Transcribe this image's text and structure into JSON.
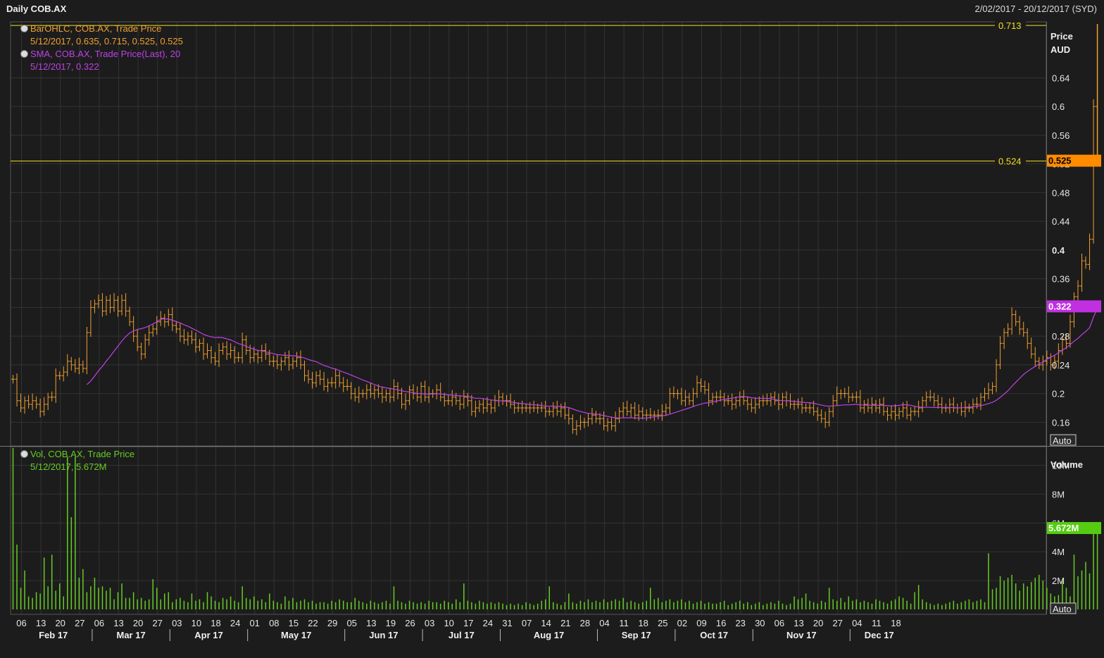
{
  "header": {
    "title": "Daily COB.AX",
    "date_range": "2/02/2017 - 20/12/2017 (SYD)"
  },
  "legend": {
    "ohlc_name": "BarOHLC, COB.AX, Trade Price",
    "ohlc_values": "5/12/2017, 0.635, 0.715, 0.525, 0.525",
    "sma_name": "SMA, COB.AX, Trade Price(Last),  20",
    "sma_values": "5/12/2017, 0.322",
    "vol_name": "Vol, COB.AX, Trade Price",
    "vol_values": "5/12/2017, 5.672M"
  },
  "colors": {
    "background": "#1c1c1c",
    "grid": "#333333",
    "ohlc": "#f0a030",
    "sma": "#c040e8",
    "volume": "#66cc22",
    "hline": "#f0e020",
    "last_price_badge": "#ff8c00",
    "sma_badge": "#c030e0",
    "volume_badge": "#55cc11"
  },
  "chart_data": {
    "type": "line",
    "price_axis": {
      "label_line1": "Price",
      "label_line2": "AUD",
      "ticks": [
        0.16,
        0.2,
        0.24,
        0.28,
        0.32,
        0.36,
        0.4,
        0.44,
        0.48,
        0.52,
        0.56,
        0.6,
        0.64
      ],
      "tick_labels": [
        "0.16",
        "0.2",
        "0.24",
        "0.28",
        "0.32",
        "0.36",
        "0.4",
        "0.44",
        "0.48",
        "0.52",
        "0.56",
        "0.6",
        "0.64"
      ],
      "ylim": [
        0.127,
        0.718
      ],
      "mode_button": "Auto"
    },
    "volume_axis": {
      "label": "Volume",
      "ticks": [
        2,
        4,
        6,
        8,
        10
      ],
      "tick_labels": [
        "2M",
        "4M",
        "6M",
        "8M",
        "10M"
      ],
      "ylim": [
        0,
        11.2
      ],
      "mode_button": "Auto"
    },
    "x_axis": {
      "day_labels": [
        "06",
        "13",
        "20",
        "27",
        "06",
        "13",
        "20",
        "27",
        "03",
        "10",
        "18",
        "24",
        "01",
        "08",
        "15",
        "22",
        "29",
        "05",
        "13",
        "19",
        "26",
        "03",
        "10",
        "17",
        "24",
        "31",
        "07",
        "14",
        "21",
        "28",
        "04",
        "11",
        "18",
        "25",
        "02",
        "09",
        "16",
        "23",
        "30",
        "06",
        "13",
        "20",
        "27",
        "04",
        "11",
        "18"
      ],
      "month_labels": [
        "Feb 17",
        "Mar 17",
        "Apr 17",
        "May 17",
        "Jun 17",
        "Jul 17",
        "Aug 17",
        "Sep 17",
        "Oct 17",
        "Nov 17",
        "Dec 17"
      ],
      "bars_per_label": 5
    },
    "horizontal_lines": [
      {
        "value": 0.713,
        "label": "0.713"
      },
      {
        "value": 0.524,
        "label": "0.524"
      }
    ],
    "last_price": {
      "value": 0.525,
      "label": "0.525"
    },
    "sma_last": {
      "value": 0.322,
      "label": "0.322"
    },
    "volume_last": {
      "value": 5.672,
      "label": "5.672M"
    },
    "close": [
      0.22,
      0.19,
      0.18,
      0.19,
      0.185,
      0.19,
      0.185,
      0.175,
      0.185,
      0.195,
      0.195,
      0.225,
      0.225,
      0.23,
      0.245,
      0.24,
      0.235,
      0.24,
      0.235,
      0.285,
      0.32,
      0.325,
      0.33,
      0.315,
      0.33,
      0.32,
      0.33,
      0.315,
      0.33,
      0.315,
      0.3,
      0.28,
      0.265,
      0.255,
      0.275,
      0.285,
      0.29,
      0.3,
      0.305,
      0.3,
      0.31,
      0.295,
      0.29,
      0.28,
      0.275,
      0.28,
      0.275,
      0.265,
      0.27,
      0.255,
      0.26,
      0.25,
      0.245,
      0.26,
      0.265,
      0.255,
      0.26,
      0.25,
      0.25,
      0.275,
      0.26,
      0.25,
      0.255,
      0.25,
      0.26,
      0.255,
      0.245,
      0.245,
      0.24,
      0.245,
      0.25,
      0.24,
      0.245,
      0.25,
      0.24,
      0.225,
      0.22,
      0.215,
      0.225,
      0.22,
      0.21,
      0.215,
      0.215,
      0.225,
      0.215,
      0.21,
      0.21,
      0.2,
      0.195,
      0.2,
      0.2,
      0.205,
      0.2,
      0.205,
      0.2,
      0.195,
      0.2,
      0.195,
      0.21,
      0.2,
      0.185,
      0.19,
      0.205,
      0.2,
      0.195,
      0.21,
      0.195,
      0.2,
      0.2,
      0.205,
      0.195,
      0.19,
      0.19,
      0.195,
      0.19,
      0.185,
      0.195,
      0.19,
      0.175,
      0.18,
      0.185,
      0.18,
      0.185,
      0.18,
      0.19,
      0.195,
      0.19,
      0.19,
      0.185,
      0.18,
      0.18,
      0.18,
      0.18,
      0.18,
      0.18,
      0.18,
      0.18,
      0.175,
      0.175,
      0.18,
      0.175,
      0.18,
      0.17,
      0.165,
      0.15,
      0.155,
      0.16,
      0.16,
      0.165,
      0.17,
      0.165,
      0.165,
      0.155,
      0.16,
      0.155,
      0.165,
      0.175,
      0.18,
      0.175,
      0.18,
      0.17,
      0.175,
      0.17,
      0.17,
      0.17,
      0.17,
      0.17,
      0.175,
      0.18,
      0.2,
      0.2,
      0.2,
      0.19,
      0.195,
      0.19,
      0.2,
      0.215,
      0.21,
      0.205,
      0.19,
      0.195,
      0.195,
      0.195,
      0.19,
      0.19,
      0.185,
      0.19,
      0.195,
      0.19,
      0.185,
      0.18,
      0.185,
      0.19,
      0.19,
      0.19,
      0.195,
      0.19,
      0.185,
      0.195,
      0.19,
      0.185,
      0.185,
      0.185,
      0.18,
      0.18,
      0.18,
      0.175,
      0.17,
      0.165,
      0.16,
      0.175,
      0.19,
      0.2,
      0.2,
      0.2,
      0.195,
      0.195,
      0.195,
      0.18,
      0.185,
      0.18,
      0.185,
      0.18,
      0.185,
      0.175,
      0.17,
      0.175,
      0.17,
      0.175,
      0.18,
      0.17,
      0.175,
      0.175,
      0.18,
      0.19,
      0.195,
      0.195,
      0.19,
      0.185,
      0.18,
      0.18,
      0.185,
      0.18,
      0.18,
      0.175,
      0.18,
      0.18,
      0.185,
      0.185,
      0.195,
      0.2,
      0.205,
      0.21,
      0.24,
      0.27,
      0.285,
      0.29,
      0.31,
      0.3,
      0.29,
      0.285,
      0.27,
      0.255,
      0.245,
      0.24,
      0.245,
      0.25,
      0.24,
      0.245,
      0.26,
      0.275,
      0.27,
      0.3,
      0.335,
      0.35,
      0.385,
      0.38,
      0.415,
      0.6,
      0.525
    ],
    "volume": [
      11.8,
      4.5,
      1.5,
      2.7,
      0.9,
      0.8,
      1.2,
      1.1,
      3.6,
      1.6,
      3.8,
      1.3,
      1.8,
      0.9,
      10.6,
      6.4,
      10.6,
      2.2,
      2.8,
      1.2,
      1.6,
      2.2,
      1.5,
      1.6,
      1.3,
      1.5,
      0.7,
      1.2,
      1.8,
      0.8,
      0.8,
      1.2,
      0.7,
      0.8,
      0.6,
      0.7,
      2.1,
      1.5,
      0.7,
      1.1,
      1.2,
      0.5,
      0.7,
      0.8,
      0.6,
      0.5,
      1.1,
      0.6,
      0.7,
      0.5,
      1.2,
      0.9,
      0.6,
      0.5,
      0.8,
      0.7,
      0.9,
      0.6,
      0.5,
      1.6,
      0.8,
      0.7,
      0.9,
      0.6,
      0.7,
      0.5,
      1.1,
      0.6,
      0.5,
      0.4,
      0.9,
      0.6,
      0.8,
      0.5,
      0.6,
      0.7,
      0.5,
      0.6,
      0.4,
      0.5,
      0.5,
      0.4,
      0.6,
      0.5,
      0.7,
      0.6,
      0.5,
      0.5,
      0.8,
      0.6,
      0.5,
      0.4,
      0.6,
      0.5,
      0.4,
      0.5,
      0.6,
      0.4,
      1.6,
      0.6,
      0.5,
      0.4,
      0.6,
      0.5,
      0.4,
      0.5,
      0.4,
      0.6,
      0.5,
      0.5,
      0.4,
      0.6,
      0.5,
      0.4,
      0.7,
      0.5,
      1.8,
      0.6,
      0.5,
      0.4,
      0.6,
      0.5,
      0.4,
      0.5,
      0.4,
      0.5,
      0.4,
      0.3,
      0.4,
      0.3,
      0.4,
      0.3,
      0.5,
      0.4,
      0.3,
      0.4,
      0.6,
      0.7,
      1.6,
      0.5,
      0.4,
      0.3,
      0.5,
      1.1,
      0.5,
      0.4,
      0.6,
      0.5,
      0.7,
      0.5,
      0.6,
      0.5,
      0.7,
      0.5,
      0.6,
      0.7,
      0.6,
      0.8,
      0.5,
      0.6,
      0.5,
      0.4,
      0.5,
      0.6,
      1.5,
      0.7,
      0.8,
      0.5,
      0.6,
      0.7,
      0.5,
      0.6,
      0.7,
      0.5,
      0.6,
      0.4,
      0.5,
      0.6,
      0.4,
      0.5,
      0.4,
      0.4,
      0.5,
      0.6,
      0.3,
      0.4,
      0.5,
      0.6,
      0.4,
      0.5,
      0.3,
      0.4,
      0.5,
      0.3,
      0.4,
      0.5,
      0.4,
      0.6,
      0.4,
      0.3,
      0.4,
      0.9,
      0.7,
      0.8,
      1.1,
      0.6,
      0.5,
      0.4,
      0.6,
      0.5,
      1.5,
      0.7,
      0.6,
      0.8,
      0.5,
      0.9,
      0.6,
      0.7,
      0.5,
      0.6,
      0.5,
      0.4,
      0.7,
      0.6,
      0.5,
      0.4,
      0.6,
      0.7,
      0.9,
      0.8,
      0.6,
      0.4,
      1.2,
      1.7,
      0.7,
      0.5,
      0.4,
      0.3,
      0.4,
      0.3,
      0.4,
      0.5,
      0.6,
      0.4,
      0.5,
      0.6,
      0.7,
      0.5,
      0.6,
      0.7,
      0.5,
      3.9,
      1.4,
      1.5,
      2.3,
      2.0,
      2.2,
      2.4,
      1.8,
      1.3,
      1.8,
      1.6,
      1.9,
      2.2,
      2.4,
      2.0,
      1.5,
      1.1,
      0.9,
      1.0,
      2.1,
      1.5,
      0.9,
      3.8,
      2.3,
      2.7,
      3.3,
      2.5,
      5.4,
      5.672
    ]
  }
}
